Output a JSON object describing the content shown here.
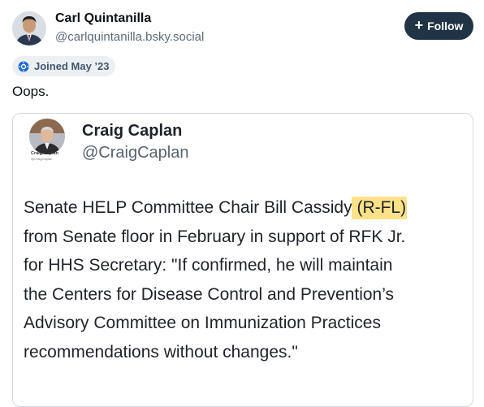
{
  "author": {
    "display_name": "Carl Quintanilla",
    "handle": "@carlquintanilla.bsky.social",
    "joined": "Joined May ’23"
  },
  "follow_button": {
    "icon": "plus-icon",
    "label": "Follow"
  },
  "post": {
    "text": "Oops."
  },
  "embedded_post": {
    "display_name": "Craig Caplan",
    "handle": "@CraigCaplan",
    "avatar_name": "Craig Caplan",
    "avatar_handle": "@CraigCaplan",
    "lines": [
      "Senate HELP Committee Chair Bill Cassidy",
      "from Senate floor in February in support of RFK Jr.",
      "for HHS Secretary: \"If confirmed, he will maintain",
      "the Centers for Disease Control and Prevention’s",
      "Advisory Committee on Immunization Practices",
      "recommendations without changes.\""
    ],
    "highlighted": "(R-FL)",
    "highlight_color": "#f7c430"
  },
  "colors": {
    "follow_bg": "#213445",
    "pill_bg": "#edf0f3",
    "handle_gray": "#5b6b7b"
  }
}
